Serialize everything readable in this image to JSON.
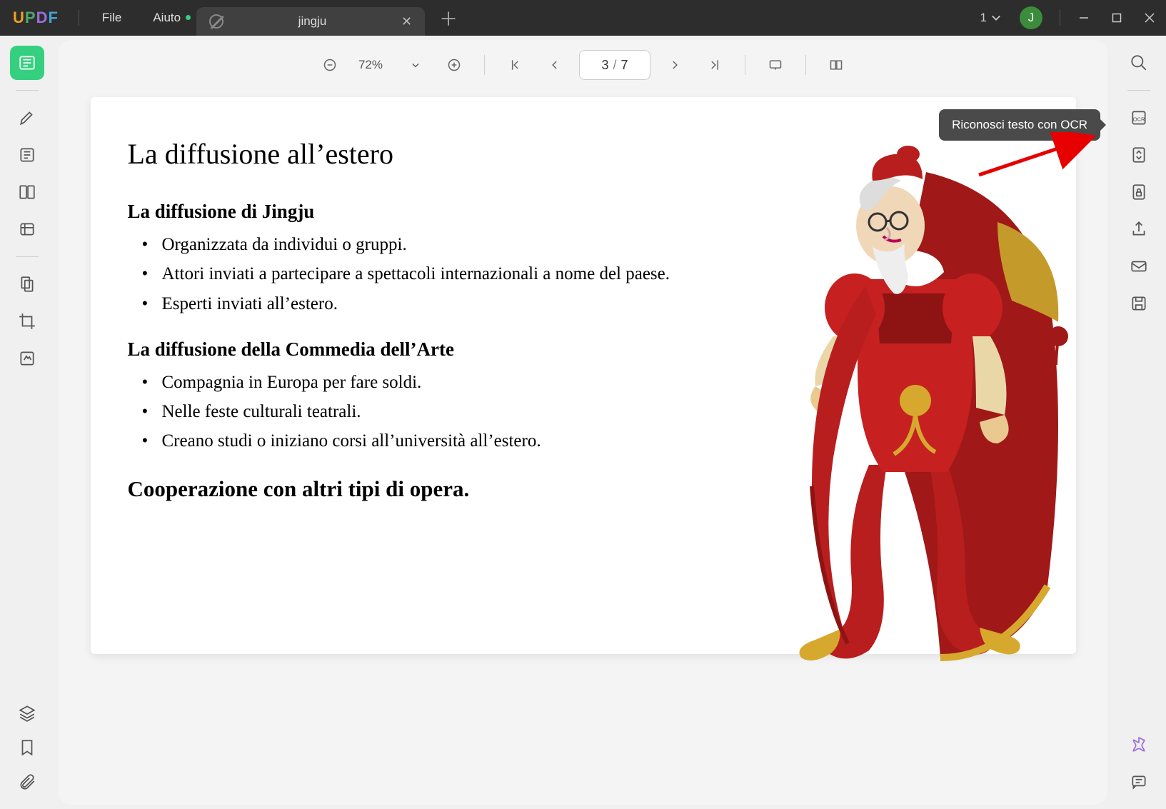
{
  "titlebar": {
    "logo": {
      "u": "U",
      "p": "P",
      "d": "D",
      "f": "F"
    },
    "menu": {
      "file": "File",
      "help": "Aiuto"
    },
    "tab": {
      "label": "jingju"
    },
    "window_count": "1",
    "avatar": "J"
  },
  "toolbar": {
    "zoom": "72%",
    "current_page": "3",
    "total_pages": "7"
  },
  "tooltip": {
    "ocr": "Riconosci testo con OCR"
  },
  "document": {
    "title": "La diffusione all’estero",
    "section1_title": "La diffusione di Jingju",
    "section1_items": [
      "Organizzata da individui o gruppi.",
      "Attori inviati a partecipare a spettacoli internazionali a nome del paese.",
      "Esperti inviati all’estero."
    ],
    "section2_title": "La diffusione della Commedia dell’Arte",
    "section2_items": [
      "Compagnia in Europa per fare soldi.",
      "Nelle feste culturali teatrali.",
      "Creano studi o iniziano corsi all’università all’estero."
    ],
    "coop": "Cooperazione con altri tipi di opera."
  }
}
